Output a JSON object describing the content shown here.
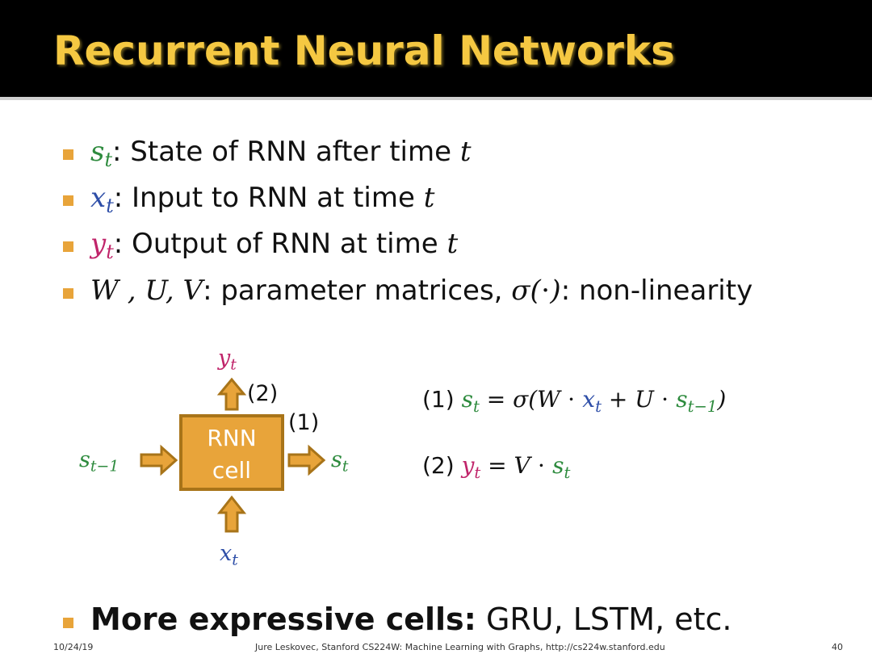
{
  "title": "Recurrent Neural Networks",
  "bullets": [
    {
      "sym": "s",
      "sub": "t",
      "text": ": State of RNN after time ",
      "tvar": "t"
    },
    {
      "sym": "x",
      "sub": "t",
      "text": ": Input to RNN at time ",
      "tvar": "t"
    },
    {
      "sym": "y",
      "sub": "t",
      "text": ": Output of RNN at time ",
      "tvar": "t"
    },
    {
      "syms": "W , U, V",
      "text": ": parameter matrices, ",
      "sigma": "σ(⋅)",
      "text2": ": non-linearity"
    }
  ],
  "diagram": {
    "cell_line1": "RNN",
    "cell_line2": "cell",
    "out_label_sym": "y",
    "out_label_sub": "t",
    "in_label_sym": "x",
    "in_label_sub": "t",
    "left_label_sym": "s",
    "left_label_sub": "t−1",
    "right_label_sym": "s",
    "right_label_sub": "t",
    "tag2": "(2)",
    "tag1": "(1)"
  },
  "equations": {
    "eq1_tag": "(1) ",
    "eq1_lhs_sym": "s",
    "eq1_lhs_sub": "t",
    "eq1_a": " = σ(W ⋅ ",
    "eq1_x": "x",
    "eq1_xsub": "t",
    "eq1_b": " + U ⋅ ",
    "eq1_s": "s",
    "eq1_ssub": "t−1",
    "eq1_c": ")",
    "eq2_tag": "(2) ",
    "eq2_lhs_sym": "y",
    "eq2_lhs_sub": "t",
    "eq2_a": " = V ⋅ ",
    "eq2_s": "s",
    "eq2_ssub": "t"
  },
  "last_bullet": {
    "bold": "More expressive cells:",
    "rest": " GRU, LSTM, etc."
  },
  "footer": {
    "date": "10/24/19",
    "credit": "Jure Leskovec, Stanford CS224W: Machine Learning with Graphs, http://cs224w.stanford.edu",
    "page": "40"
  },
  "colors": {
    "accent": "#e8a43a",
    "title": "#f5c842",
    "state": "#2e8b3e",
    "input": "#2f4fa8",
    "output": "#c0246a"
  }
}
